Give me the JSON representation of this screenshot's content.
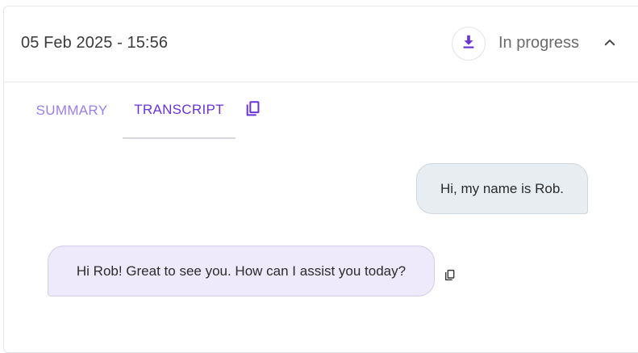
{
  "header": {
    "timestamp": "05 Feb 2025 - 15:56",
    "status": "In progress",
    "icons": {
      "download": "download-icon",
      "collapse": "chevron-up-icon"
    }
  },
  "tabs": [
    {
      "label": "SUMMARY",
      "active": false
    },
    {
      "label": "TRANSCRIPT",
      "active": true
    }
  ],
  "tab_copy_icon": "copy-icon",
  "messages": [
    {
      "role": "user",
      "text": "Hi, my name is Rob."
    },
    {
      "role": "assistant",
      "text": "Hi Rob! Great to see you. How can I assist you today?"
    }
  ],
  "colors": {
    "accent": "#6a33d8",
    "accent_light": "#9b7fe6",
    "user_bubble": "#e8edf1",
    "assistant_bubble": "#efeafb"
  }
}
